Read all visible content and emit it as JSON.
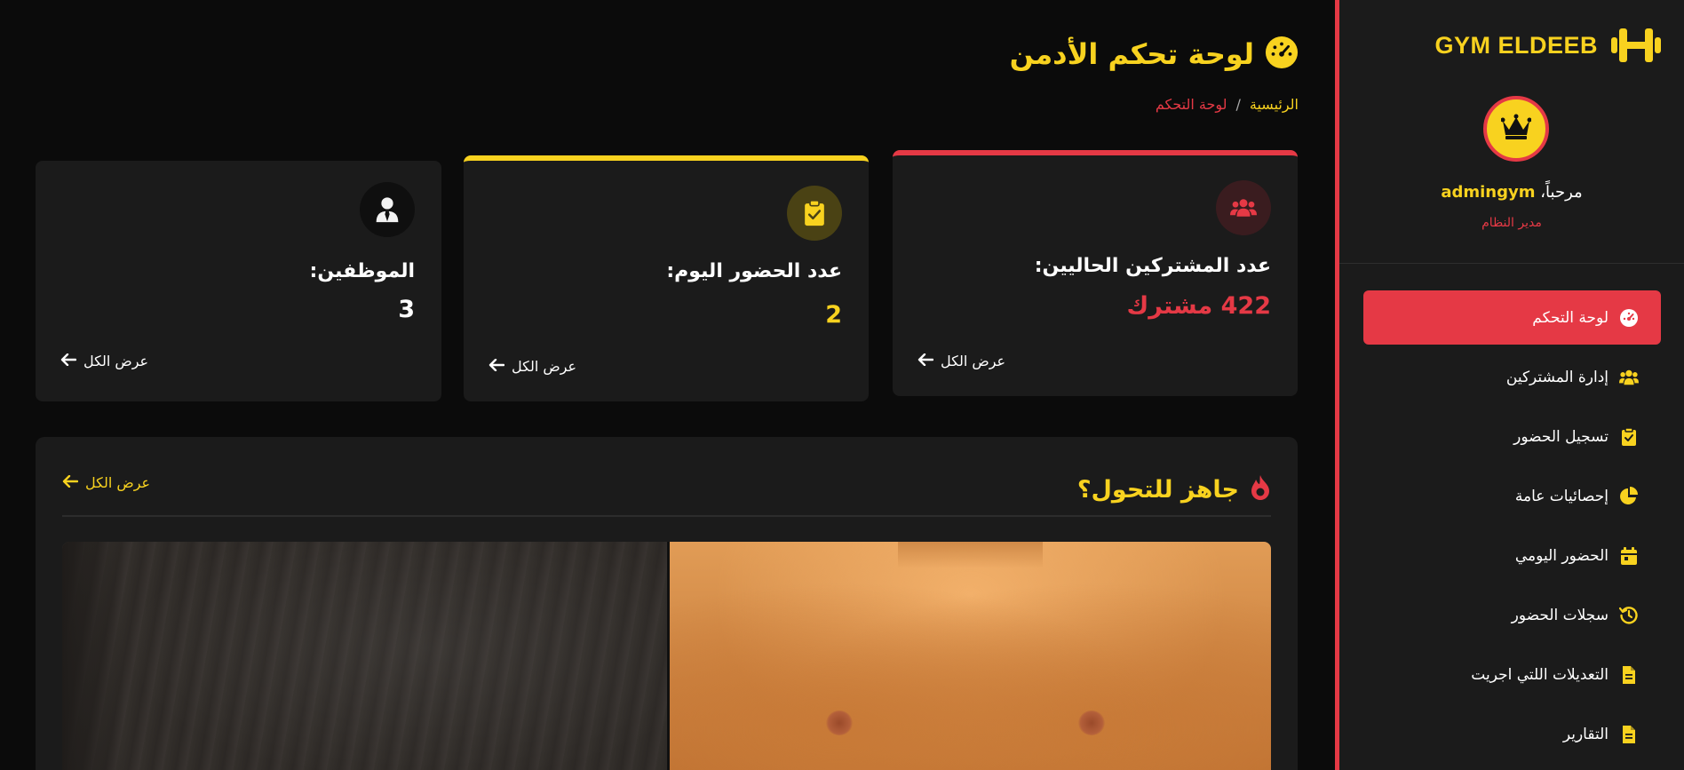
{
  "colors": {
    "accent_yellow": "#f8d21f",
    "accent_red": "#e53945",
    "card_bg": "#1b1b1b",
    "page_bg": "#0b0b0b"
  },
  "sidebar": {
    "brand": "GYM ELDEEB",
    "brand_icon": "dumbbell-icon",
    "avatar_icon": "crown-icon",
    "welcome_prefix": "مرحباً،",
    "username": "admingym",
    "role": "مدير النظام",
    "items": [
      {
        "label": "لوحة التحكم",
        "icon": "gauge-icon",
        "active": true
      },
      {
        "label": "إدارة المشتركين",
        "icon": "users-icon",
        "active": false
      },
      {
        "label": "تسجيل الحضور",
        "icon": "clipboard-check-icon",
        "active": false
      },
      {
        "label": "إحصائيات عامة",
        "icon": "pie-chart-icon",
        "active": false
      },
      {
        "label": "الحضور اليومي",
        "icon": "calendar-icon",
        "active": false
      },
      {
        "label": "سجلات الحضور",
        "icon": "history-icon",
        "active": false
      },
      {
        "label": "التعديلات اللتي اجريت",
        "icon": "file-icon",
        "active": false
      },
      {
        "label": "التقارير",
        "icon": "file-icon",
        "active": false
      }
    ]
  },
  "header": {
    "title": "لوحة تحكم الأدمن",
    "title_icon": "gauge-icon",
    "breadcrumb": {
      "home": "الرئيسية",
      "separator": "/",
      "current": "لوحة التحكم"
    }
  },
  "cards": [
    {
      "label": "عدد المشتركين الحاليين:",
      "value": "422 مشترك",
      "link": "عرض الكل",
      "icon": "users-icon"
    },
    {
      "label": "عدد الحضور اليوم:",
      "value": "2",
      "link": "عرض الكل",
      "icon": "clipboard-check-icon"
    },
    {
      "label": "الموظفين:",
      "value": "3",
      "link": "عرض الكل",
      "icon": "user-tie-icon"
    }
  ],
  "promo": {
    "title": "جاهز للتحول؟",
    "icon": "fire-icon",
    "link": "عرض الكل"
  }
}
